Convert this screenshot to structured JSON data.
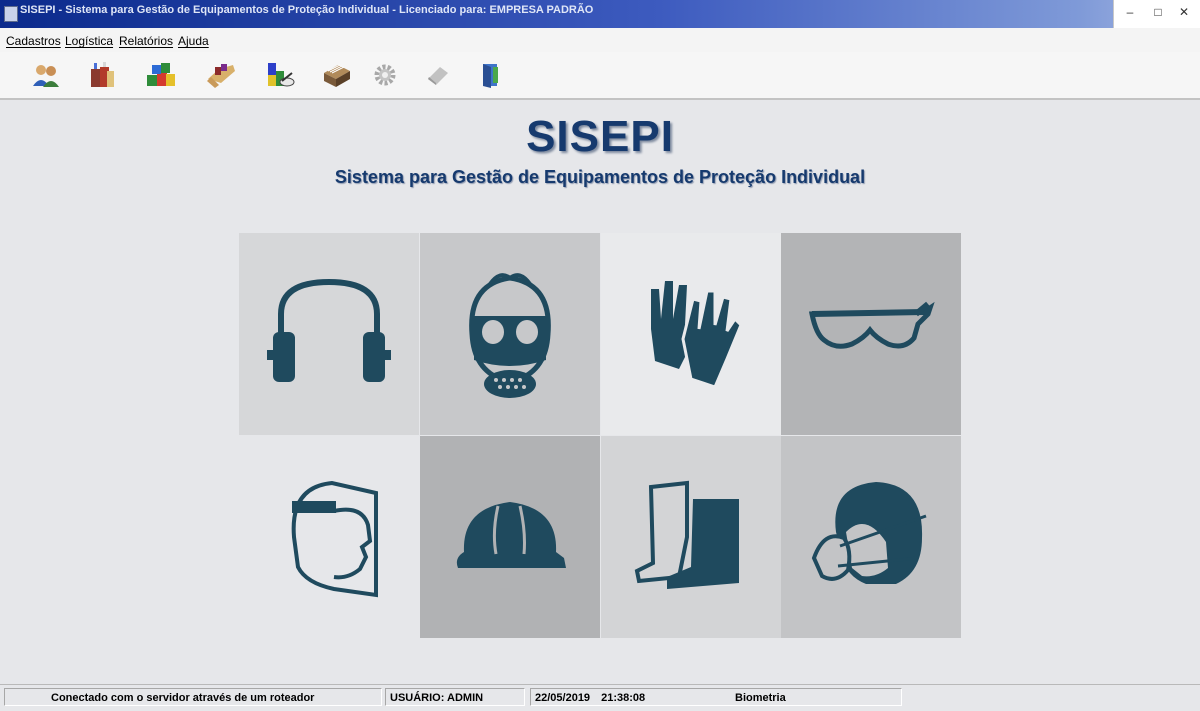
{
  "window": {
    "title": "SISEPI - Sistema para Gestão de Equipamentos de Proteção Individual - Licenciado para: EMPRESA PADRÃO",
    "controls": {
      "minimize": "–",
      "maximize": "□",
      "close": "✕"
    }
  },
  "menu": {
    "items": [
      {
        "label": "Cadastros"
      },
      {
        "label": "Logística"
      },
      {
        "label": "Relatórios"
      },
      {
        "label": "Ajuda"
      }
    ]
  },
  "toolbar": {
    "icons": [
      "users-icon",
      "gift-boxes-icon",
      "colored-boxes-icon",
      "hand-with-items-icon",
      "color-blocks-icon",
      "file-box-icon",
      "gear-icon",
      "eraser-icon",
      "exit-door-icon"
    ]
  },
  "main": {
    "logo": "SISEPI",
    "subtitle": "Sistema para Gestão de Equipamentos de Proteção Individual"
  },
  "ppe_tiles": [
    {
      "icon": "ear-muffs-icon",
      "color": "#d6d7d9"
    },
    {
      "icon": "gas-mask-icon",
      "color": "#c7c8ca"
    },
    {
      "icon": "gloves-icon",
      "color": "#e9eaec"
    },
    {
      "icon": "safety-glasses-icon",
      "color": "#b3b4b6"
    },
    {
      "icon": "face-shield-icon",
      "color": "#e6e7ea"
    },
    {
      "icon": "hard-hat-icon",
      "color": "#b1b2b4"
    },
    {
      "icon": "boots-icon",
      "color": "#d3d4d6"
    },
    {
      "icon": "respirator-mask-icon",
      "color": "#c3c4c6"
    }
  ],
  "status": {
    "connection": "Conectado com o servidor através de um roteador",
    "user": "USUÁRIO: ADMIN",
    "date": "22/05/2019",
    "time": "21:38:08",
    "module": "Biometria"
  },
  "colors": {
    "accent": "#163a6e",
    "icon": "#1f4a5e",
    "titlebar": "#0b2a8c"
  }
}
